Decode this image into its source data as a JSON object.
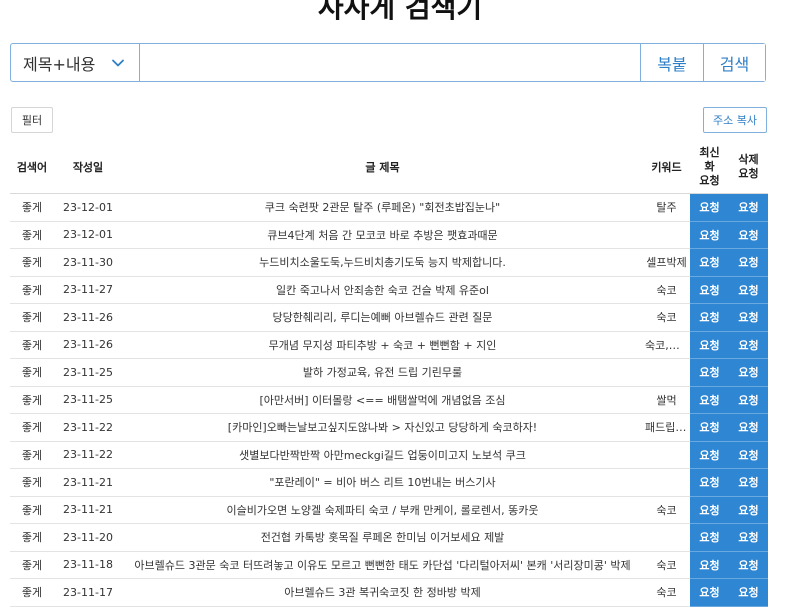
{
  "page_title": "사사게 검색기",
  "search": {
    "select_value": "제목+내용",
    "query_value": "",
    "paste_label": "복붙",
    "search_label": "검색"
  },
  "filter_label": "필터",
  "copy_address_label": "주소 복사",
  "table": {
    "headers": {
      "keyword": "검색어",
      "date": "작성일",
      "title": "글 제목",
      "tags": "키워드",
      "refresh": [
        "최신",
        "화",
        "요청"
      ],
      "delete": [
        "삭제",
        "요청"
      ]
    },
    "request_label": "요청",
    "rows": [
      {
        "keyword": "좋게",
        "date": "23-12-01",
        "title": "쿠크 숙련팟 2관문 탈주 (루페온) \"회전초밥집눈나\"",
        "tags": "탈주"
      },
      {
        "keyword": "좋게",
        "date": "23-12-01",
        "title": "큐브4단계 처음 간 모코코 바로 추방은 팻효과때문",
        "tags": ""
      },
      {
        "keyword": "좋게",
        "date": "23-11-30",
        "title": "누드비치소울도둑,누드비치총기도둑 능지 박제합니다.",
        "tags": "셀프박제"
      },
      {
        "keyword": "좋게",
        "date": "23-11-27",
        "title": "일칸 죽고나서 안죄송한 숙코 건슬 박제 유준ol",
        "tags": "숙코"
      },
      {
        "keyword": "좋게",
        "date": "23-11-26",
        "title": "당당한췌리리, 루디는예뻐 아브렐슈드 관련 질문",
        "tags": "숙코"
      },
      {
        "keyword": "좋게",
        "date": "23-11-26",
        "title": "무개념 무지성 파티추방 + 숙코 + 뻔뻔함 + 지인",
        "tags": "숙코,무개념"
      },
      {
        "keyword": "좋게",
        "date": "23-11-25",
        "title": "발하 가정교육, 유전 드립 기린무룰",
        "tags": ""
      },
      {
        "keyword": "좋게",
        "date": "23-11-25",
        "title": "[아만서버] 이터몰랑 <== 배탬쌀먹에 개념없음 조심",
        "tags": "쌀먹"
      },
      {
        "keyword": "좋게",
        "date": "23-11-22",
        "title": "[카마인]오빠는날보고싶지도않나봐 > 자신있고 당당하게 숙코하자!",
        "tags": "패드립,숙코"
      },
      {
        "keyword": "좋게",
        "date": "23-11-22",
        "title": "샛별보다반짝반짝 아만meckgi길드 업둥이미고지 노보석 쿠크",
        "tags": ""
      },
      {
        "keyword": "좋게",
        "date": "23-11-21",
        "title": "\"포란레이\" = 비아 버스 리트 10번내는 버스기사",
        "tags": ""
      },
      {
        "keyword": "좋게",
        "date": "23-11-21",
        "title": "이슬비가오면 노양겔 숙제파티 숙코 / 부캐 만케이, 롤로렌서, 똥카웃",
        "tags": "숙코"
      },
      {
        "keyword": "좋게",
        "date": "23-11-20",
        "title": "전건협 카톡방 홋목질 루페온 한미님 이거보세요 제발",
        "tags": ""
      },
      {
        "keyword": "좋게",
        "date": "23-11-18",
        "title": "아브렐슈드 3관문 숙코 터뜨려놓고 이유도 모르고 뻔뻔한 태도 카단섭 '다리털아저씨' 본캐 '서리장미콩' 박제",
        "tags": "숙코"
      },
      {
        "keyword": "좋게",
        "date": "23-11-17",
        "title": "아브렐슈드 3관 복귀숙코짓 한 정바방 박제",
        "tags": "숙코"
      }
    ]
  }
}
